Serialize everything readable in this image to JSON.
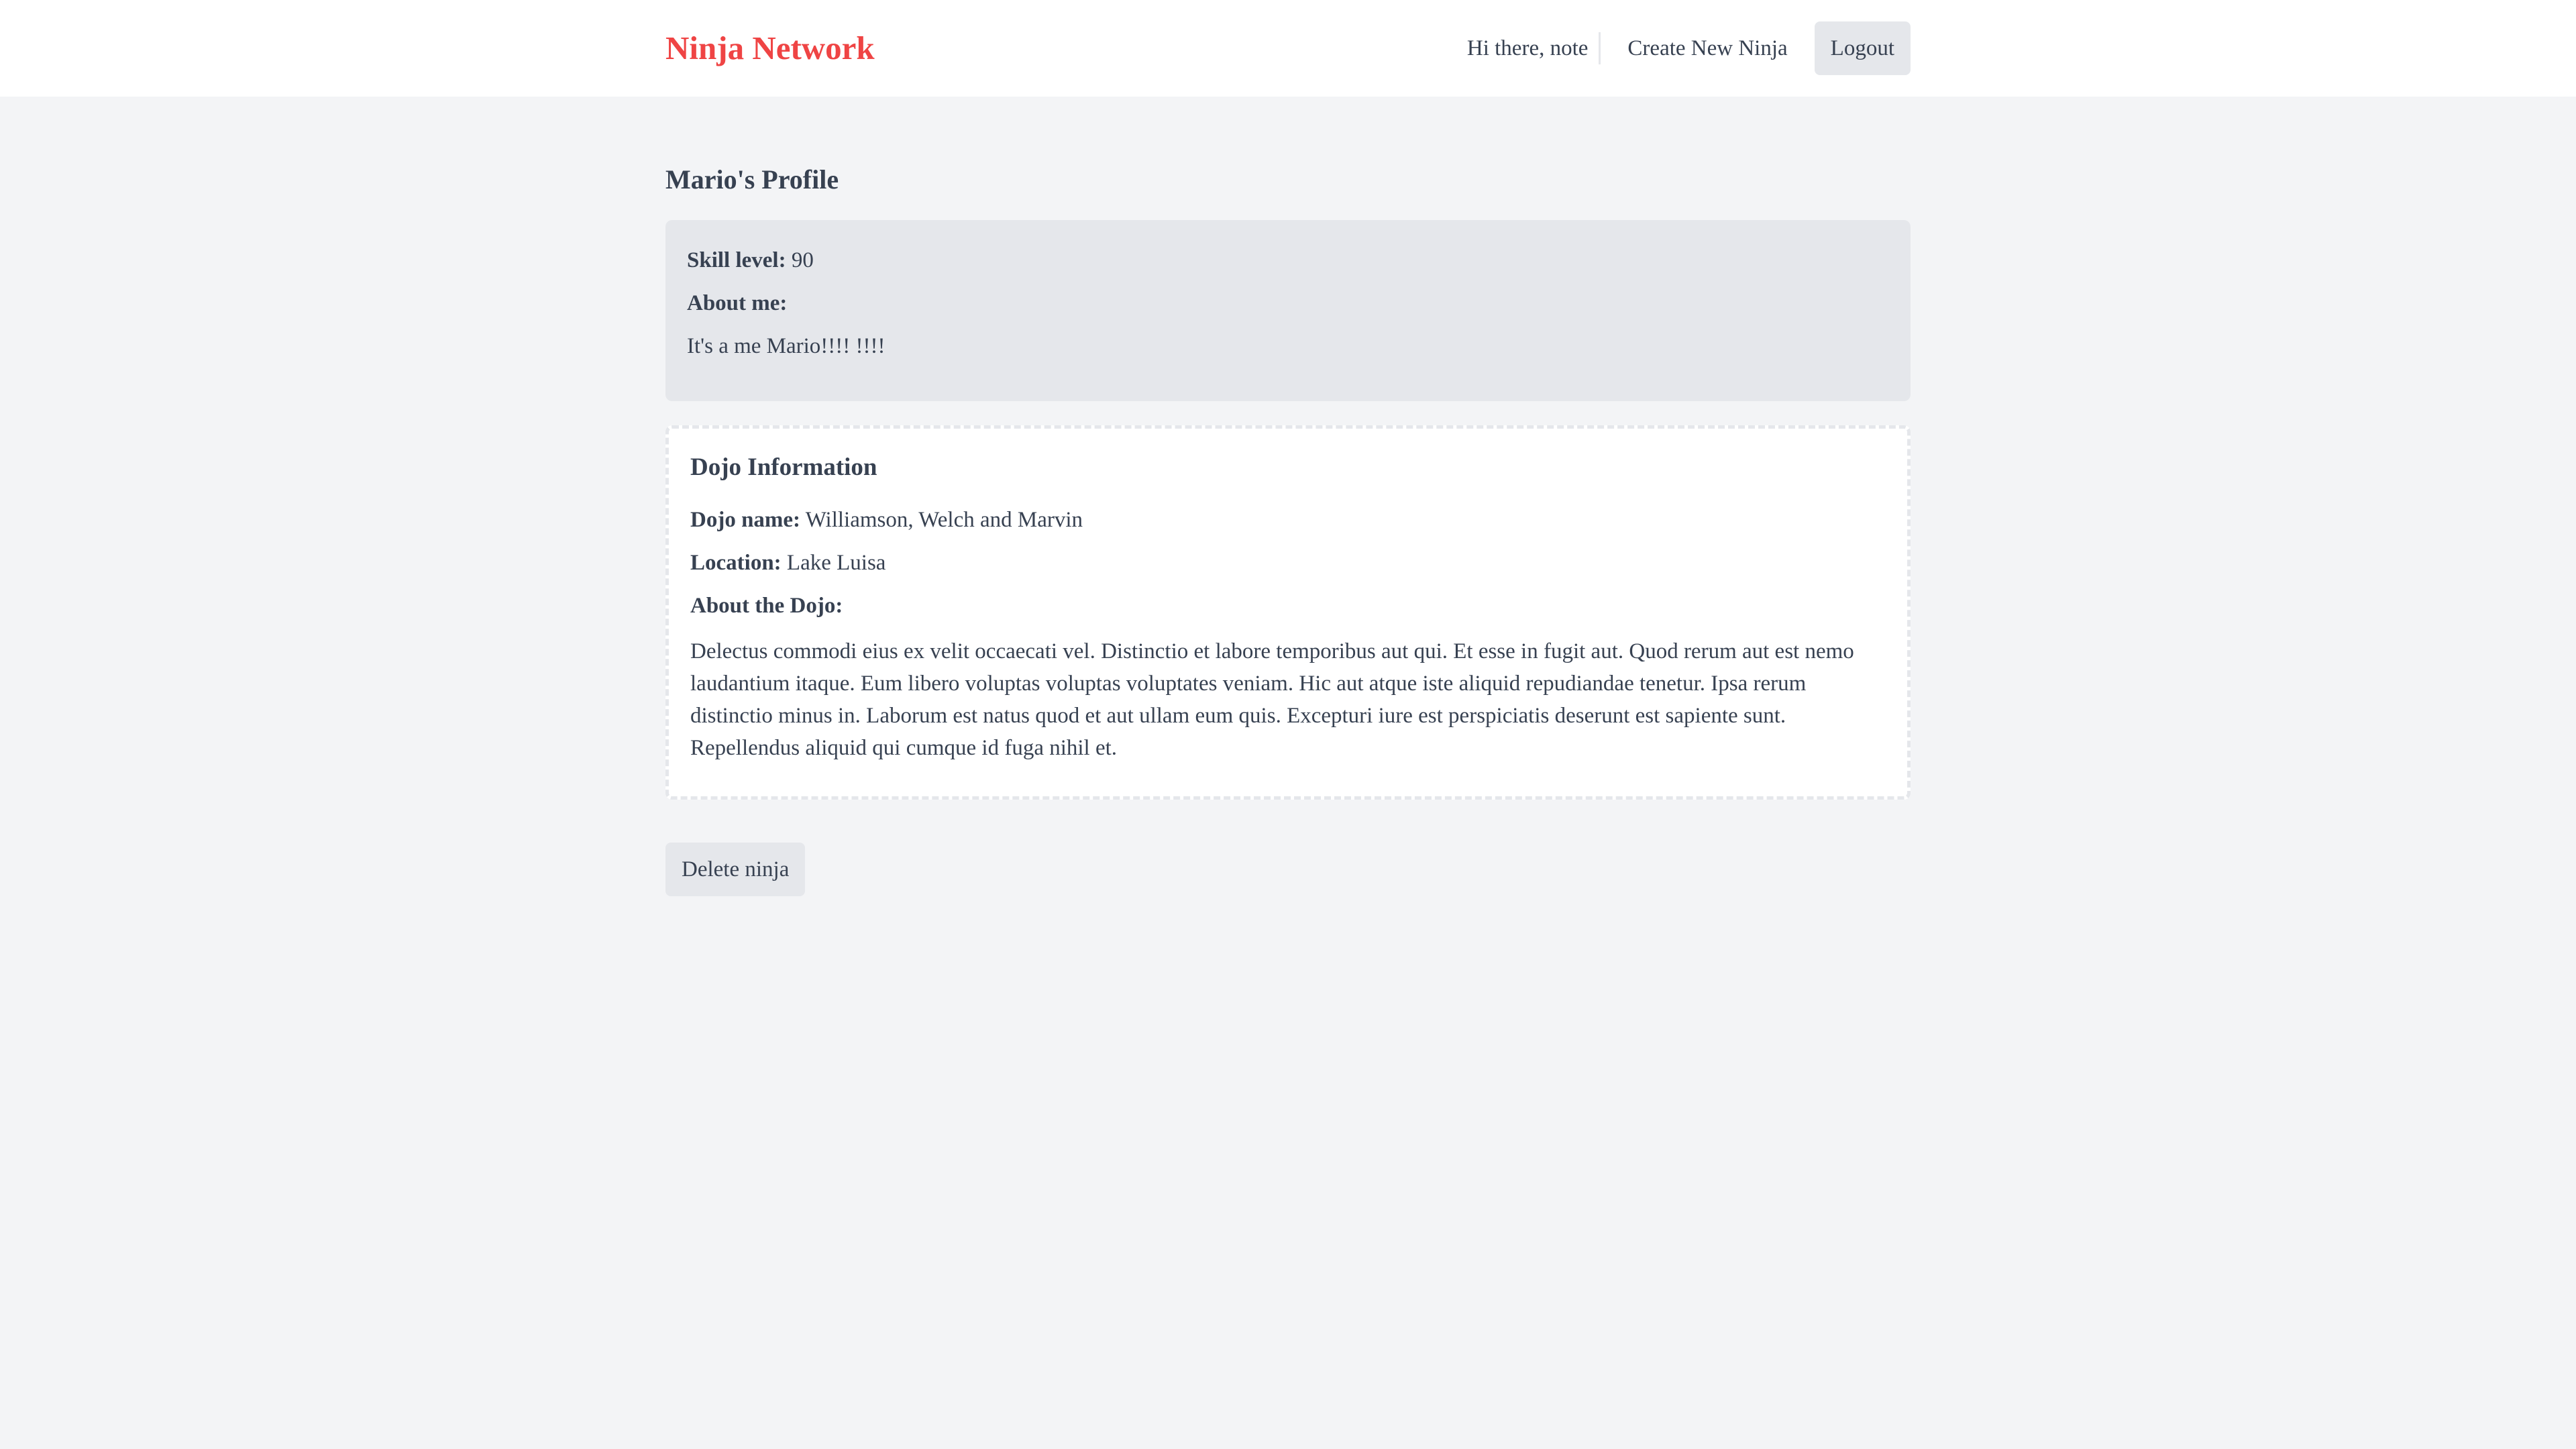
{
  "header": {
    "brand": "Ninja Network",
    "greeting": "Hi there, note",
    "create_link": "Create New Ninja",
    "logout_label": "Logout"
  },
  "profile": {
    "title": "Mario's Profile",
    "skill_label": "Skill level:",
    "skill_value": "90",
    "about_label": "About me:",
    "about_text": "It's a me Mario!!!! !!!!"
  },
  "dojo": {
    "title": "Dojo Information",
    "name_label": "Dojo name:",
    "name_value": "Williamson, Welch and Marvin",
    "location_label": "Location:",
    "location_value": "Lake Luisa",
    "about_label": "About the Dojo:",
    "about_text": "Delectus commodi eius ex velit occaecati vel. Distinctio et labore temporibus aut qui. Et esse in fugit aut. Quod rerum aut est nemo laudantium itaque. Eum libero voluptas voluptas voluptates veniam. Hic aut atque iste aliquid repudiandae tenetur. Ipsa rerum distinctio minus in. Laborum est natus quod et aut ullam eum quis. Excepturi iure est perspiciatis deserunt est sapiente sunt. Repellendus aliquid qui cumque id fuga nihil et."
  },
  "actions": {
    "delete_label": "Delete ninja"
  },
  "colors": {
    "brand": "#ef4444",
    "background": "#f3f4f6",
    "card": "#e5e7eb",
    "text": "#374151"
  }
}
